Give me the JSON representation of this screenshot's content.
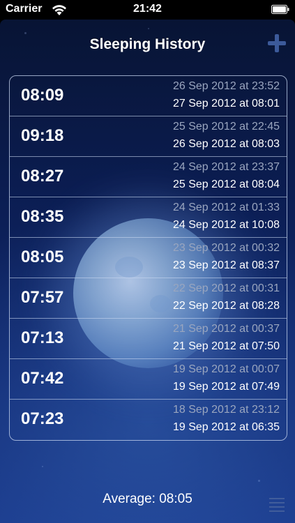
{
  "status_bar": {
    "carrier": "Carrier",
    "time": "21:42"
  },
  "header": {
    "title": "Sleeping History",
    "add_icon": "plus-icon"
  },
  "history": [
    {
      "duration": "08:09",
      "start": "26 Sep 2012 at 23:52",
      "end": "27 Sep 2012 at 08:01"
    },
    {
      "duration": "09:18",
      "start": "25 Sep 2012 at 22:45",
      "end": "26 Sep 2012 at 08:03"
    },
    {
      "duration": "08:27",
      "start": "24 Sep 2012 at 23:37",
      "end": "25 Sep 2012 at 08:04"
    },
    {
      "duration": "08:35",
      "start": "24 Sep 2012 at 01:33",
      "end": "24 Sep 2012 at 10:08"
    },
    {
      "duration": "08:05",
      "start": "23 Sep 2012 at 00:32",
      "end": "23 Sep 2012 at 08:37"
    },
    {
      "duration": "07:57",
      "start": "22 Sep 2012 at 00:31",
      "end": "22 Sep 2012 at 08:28"
    },
    {
      "duration": "07:13",
      "start": "21 Sep 2012 at 00:37",
      "end": "21 Sep 2012 at 07:50"
    },
    {
      "duration": "07:42",
      "start": "19 Sep 2012 at 00:07",
      "end": "19 Sep 2012 at 07:49"
    },
    {
      "duration": "07:23",
      "start": "18 Sep 2012 at 23:12",
      "end": "19 Sep 2012 at 06:35"
    }
  ],
  "footer": {
    "average": "Average: 08:05",
    "menu_icon": "menu-icon"
  },
  "colors": {
    "background_top": "#081434",
    "background_bottom": "#1a3a8c",
    "start_text": "#9aa6bf",
    "primary_text": "#ffffff"
  }
}
